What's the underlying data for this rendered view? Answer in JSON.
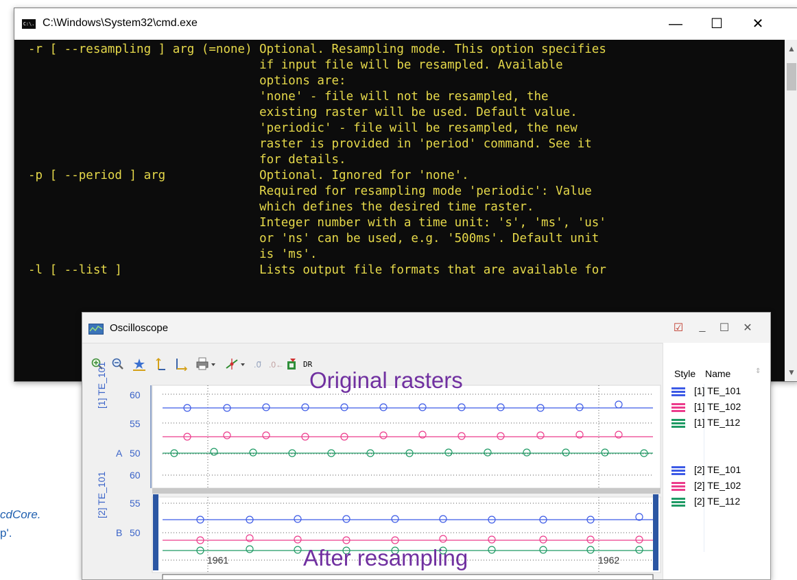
{
  "cmd_window": {
    "title": "C:\\Windows\\System32\\cmd.exe",
    "icon_text": "C:\\.",
    "controls": {
      "minimize": "—",
      "maximize": "☐",
      "close": "✕"
    },
    "lines": [
      "-r [ --resampling ] arg (=none) Optional. Resampling mode. This option specifies",
      "                                if input file will be resampled. Available",
      "                                options are:",
      "                                'none' - file will not be resampled, the",
      "                                existing raster will be used. Default value.",
      "                                'periodic' - file will be resampled, the new",
      "                                raster is provided in 'period' command. See it",
      "                                for details.",
      "-p [ --period ] arg             Optional. Ignored for 'none'.",
      "                                Required for resampling mode 'periodic': Value",
      "                                which defines the desired time raster.",
      "                                Integer number with a time unit: 's', 'ms', 'us'",
      "                                or 'ns' can be used, e.g. '500ms'. Default unit",
      "                                is 'ms'.",
      "-l [ --list ]                   Lists output file formats that are available for"
    ]
  },
  "oscilloscope": {
    "title": "Oscilloscope",
    "controls": {
      "pin": "☑",
      "minimize": "_",
      "maximize": "☐",
      "close": "✕"
    },
    "toolbar": {
      "items": [
        "zoom-in",
        "zoom-out",
        "fit",
        "vertical-axis",
        "horizontal-axis",
        "print",
        "cursor",
        "text-cursor",
        "marker",
        "export",
        "DR"
      ]
    },
    "legend_header": {
      "style": "Style",
      "name": "Name"
    },
    "legend_group_1": [
      {
        "name": "[1] TE_101",
        "color": "#3c5ae6"
      },
      {
        "name": "[1] TE_102",
        "color": "#ec3c8c"
      },
      {
        "name": "[1] TE_112",
        "color": "#1e9a64"
      }
    ],
    "legend_group_2": [
      {
        "name": "[2] TE_101",
        "color": "#3c5ae6"
      },
      {
        "name": "[2] TE_102",
        "color": "#ec3c8c"
      },
      {
        "name": "[2] TE_112",
        "color": "#1e9a64"
      }
    ],
    "panel_A": {
      "axis_label": "[1] TE_101",
      "prefix": "A",
      "ticks": [
        "60",
        "55",
        "50"
      ]
    },
    "panel_B": {
      "axis_label": "[2] TE_101",
      "prefix": "B",
      "ticks": [
        "60",
        "55",
        "50"
      ]
    },
    "x_ticks": [
      "1961",
      "1962"
    ]
  },
  "overlays": {
    "original": "Original rasters",
    "after": "After resampling"
  },
  "clipped_left": {
    "line1": "cdCore.",
    "line2": "p'."
  },
  "colors": {
    "console_text": "#e6d94a",
    "series_1": "#3c5ae6",
    "series_2": "#ec3c8c",
    "series_3": "#1e9a64",
    "panel_selected": "#2b56a3",
    "overlay_text": "#7030a0"
  }
}
